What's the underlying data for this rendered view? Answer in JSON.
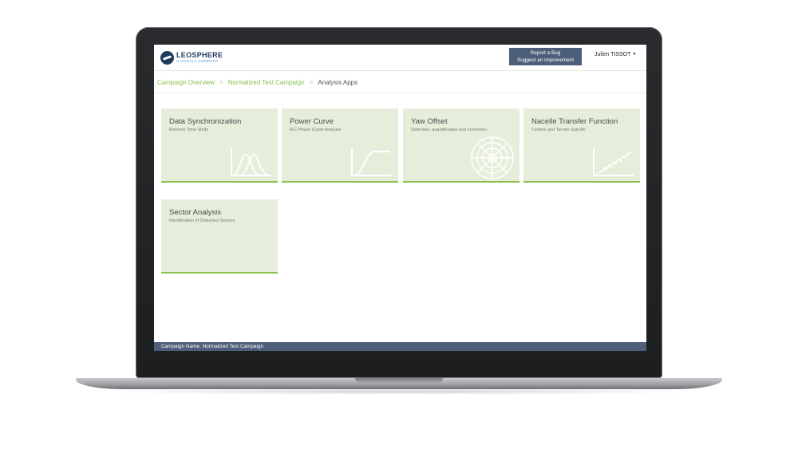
{
  "header": {
    "logo_name": "LEOSPHERE",
    "logo_sub": "A VAISALA COMPANY",
    "report_line1": "Report a Bug",
    "report_line2": "Suggest an improvement",
    "user_name": "Julien TISSOT",
    "user_caret": "▼"
  },
  "breadcrumb": {
    "items": [
      "Campaign Overview",
      "Normalized Test Campaign"
    ],
    "current": "Analysis Apps",
    "separator": ">"
  },
  "tiles": [
    {
      "title": "Data Synchronization",
      "subtitle": "Remove Time Shifts",
      "icon": "distribution-curves-icon"
    },
    {
      "title": "Power Curve",
      "subtitle": "IEC Power Curve Analysis",
      "icon": "power-curve-icon"
    },
    {
      "title": "Yaw Offset",
      "subtitle": "Detection, quantification and correction",
      "icon": "polar-target-icon"
    },
    {
      "title": "Nacelle Transfer Function",
      "subtitle": "Turbine and Terrain Specific",
      "icon": "scatter-regression-icon"
    },
    {
      "title": "Sector Analysis",
      "subtitle": "Identification of Disturbed Sectors",
      "icon": ""
    }
  ],
  "status_bar": {
    "text": "Campaign Name: Normalized Test Campaign"
  },
  "colors": {
    "accent_green": "#8cc151",
    "tile_background": "#e6eedb",
    "nav_blue": "#4d5e7b",
    "logo_blue": "#1f3b5e"
  }
}
